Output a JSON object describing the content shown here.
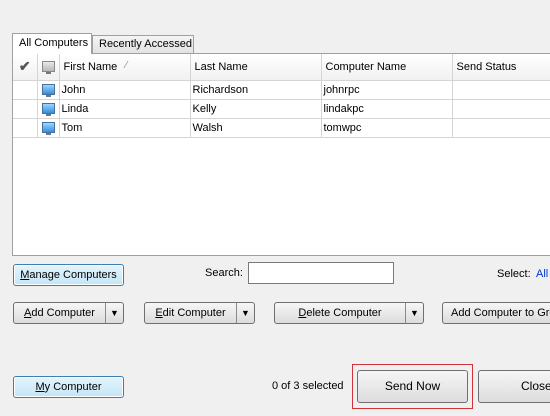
{
  "tabs": [
    {
      "label": "All Computers",
      "active": true
    },
    {
      "label": "Recently Accessed",
      "active": false
    }
  ],
  "table": {
    "columns": [
      "First Name",
      "Last Name",
      "Computer Name",
      "Send Status"
    ],
    "sort_indicator": "⁄",
    "rows": [
      {
        "first": "John",
        "last": "Richardson",
        "computer": "johnrpc",
        "status": ""
      },
      {
        "first": "Linda",
        "last": "Kelly",
        "computer": "lindakpc",
        "status": ""
      },
      {
        "first": "Tom",
        "last": "Walsh",
        "computer": "tomwpc",
        "status": ""
      }
    ]
  },
  "buttons": {
    "manage": {
      "underline": "M",
      "rest": "anage Computers"
    },
    "add": {
      "underline": "A",
      "rest": "dd Computer"
    },
    "edit": {
      "underline": "E",
      "rest": "dit Computer"
    },
    "delete": {
      "underline": "D",
      "rest": "elete Computer"
    },
    "add_to_group": "Add Computer to Gro",
    "my_computer": {
      "underline": "M",
      "rest": "y Computer"
    },
    "send_now": "Send Now",
    "close": "Close"
  },
  "search": {
    "label": "Search:",
    "value": ""
  },
  "select": {
    "label": "Select:",
    "link": "All"
  },
  "status": {
    "selected": "0 of 3 selected"
  },
  "colors": {
    "accent_border": "#d0343a",
    "blue_button": "#c4e5f6",
    "link": "#0033cc"
  }
}
